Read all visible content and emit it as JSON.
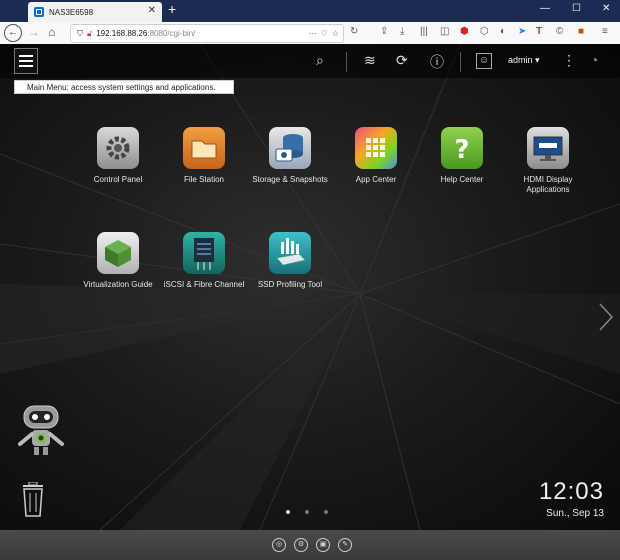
{
  "browser": {
    "tab_title": "NAS3E6598",
    "tab_close": "✕",
    "new_tab": "+",
    "window_minimize": "—",
    "window_maximize": "☐",
    "window_close": "✕",
    "url_host": "192.168.88.26",
    "url_rest": ":8080/cgi-bin/"
  },
  "qts": {
    "tooltip": "Main Menu: access system settings and applications.",
    "user": "admin ▾",
    "apps": [
      {
        "label": "Control Panel"
      },
      {
        "label": "File Station"
      },
      {
        "label": "Storage & Snapshots"
      },
      {
        "label": "App Center"
      },
      {
        "label": "Help Center"
      },
      {
        "label": "HDMI Display Applications"
      },
      {
        "label": "Virtualization Guide"
      },
      {
        "label": "iSCSI & Fibre Channel"
      },
      {
        "label": "SSD Profiling Tool"
      }
    ],
    "clock_time": "12:03",
    "clock_date": "Sun., Sep 13"
  }
}
